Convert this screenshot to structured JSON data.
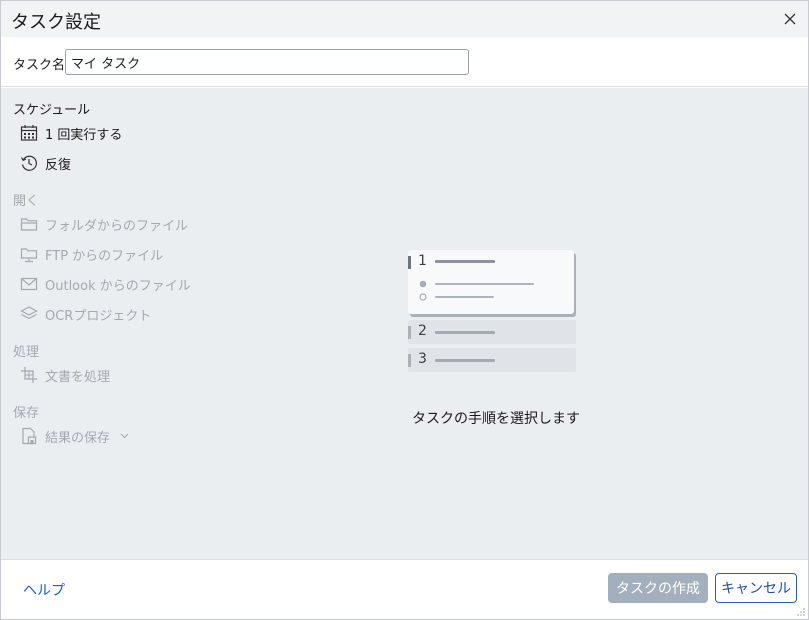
{
  "window": {
    "title": "タスク設定"
  },
  "task_name": {
    "label": "タスク名:",
    "value": "マイ タスク"
  },
  "sections": {
    "schedule": {
      "header": "スケジュール",
      "items": [
        {
          "label": "1 回実行する",
          "icon": "calendar-icon"
        },
        {
          "label": "反復",
          "icon": "recurring-clock-icon"
        }
      ]
    },
    "open": {
      "header": "開く",
      "items": [
        {
          "label": "フォルダからのファイル",
          "icon": "folder-icon"
        },
        {
          "label": "FTP からのファイル",
          "icon": "ftp-folder-icon"
        },
        {
          "label": "Outlook からのファイル",
          "icon": "mail-icon"
        },
        {
          "label": "OCRプロジェクト",
          "icon": "ocr-project-icon"
        }
      ]
    },
    "process": {
      "header": "処理",
      "items": [
        {
          "label": "文書を処理",
          "icon": "process-document-icon"
        }
      ]
    },
    "save": {
      "header": "保存",
      "items": [
        {
          "label": "結果の保存",
          "icon": "save-results-icon"
        }
      ]
    }
  },
  "illustration": {
    "steps": [
      "1",
      "2",
      "3"
    ]
  },
  "instruction": "タスクの手順を選択します",
  "footer": {
    "help": "ヘルプ",
    "create": "タスクの作成",
    "cancel": "キャンセル"
  },
  "colors": {
    "accent": "#1f5fbf",
    "disabled_text": "#a4a9b0",
    "create_button_bg": "#a3afbd",
    "panel_bg": "#ebeef1"
  }
}
